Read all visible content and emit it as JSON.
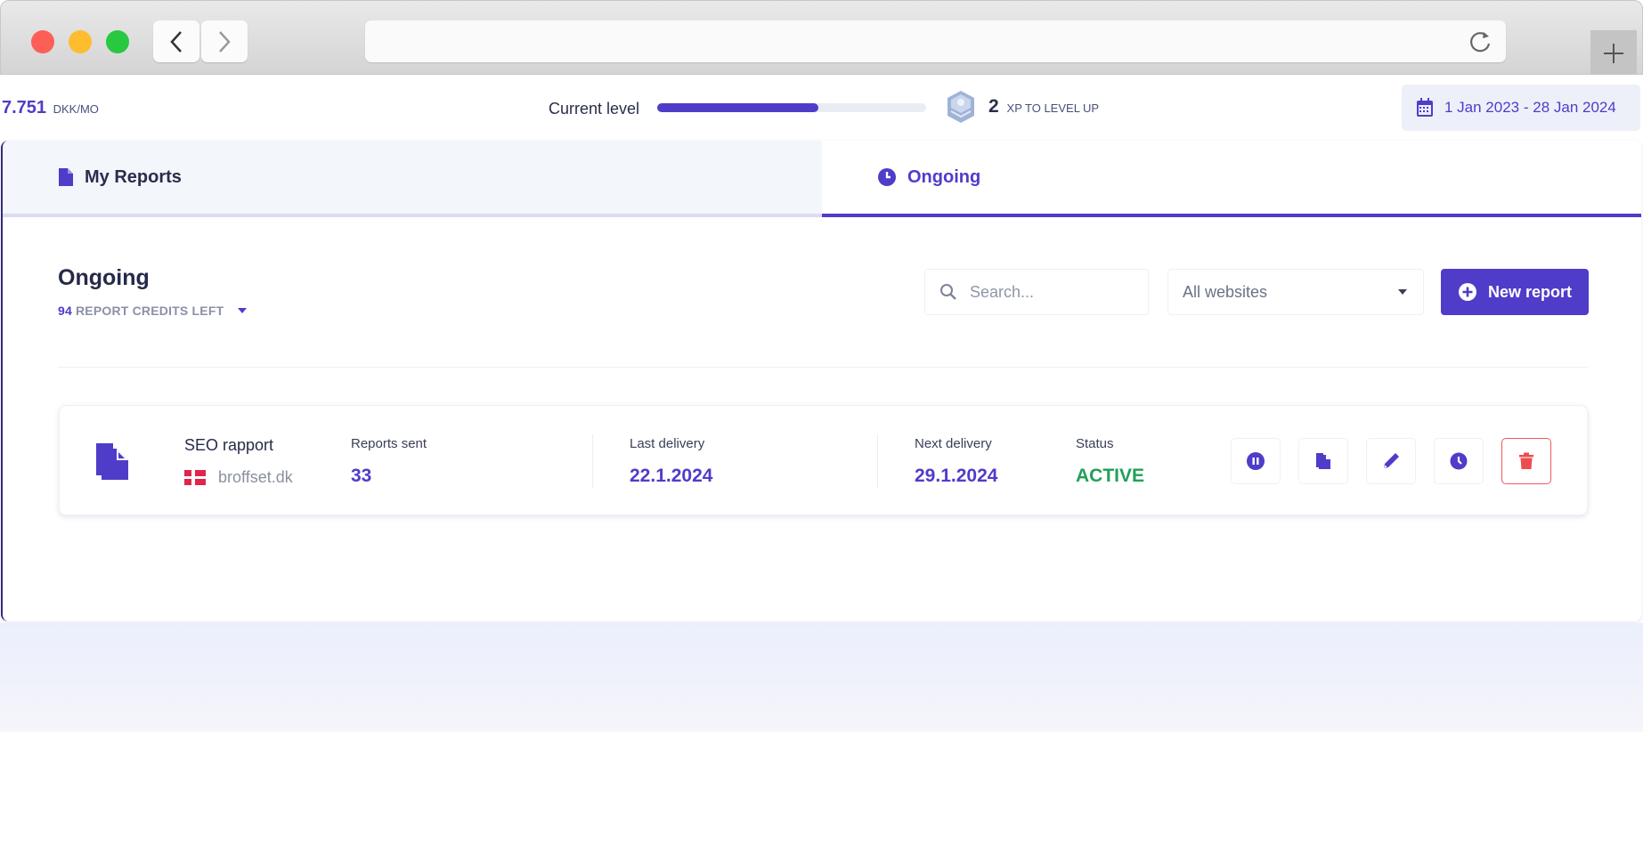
{
  "browser": {
    "back_icon": "chevron-left-icon",
    "forward_icon": "chevron-right-icon",
    "reload_icon": "reload-icon",
    "new_tab_icon": "plus-icon",
    "url": ""
  },
  "topbar": {
    "earnings_value": "7.751",
    "earnings_unit": "DKK/MO",
    "level_label": "Current level",
    "level_progress_percent": 60,
    "xp_value": "2",
    "xp_label": "XP TO LEVEL UP",
    "date_range": "1 Jan 2023 - 28 Jan 2024"
  },
  "tabs": [
    {
      "label": "My Reports",
      "icon": "file-icon",
      "active": false
    },
    {
      "label": "Ongoing",
      "icon": "clock-icon",
      "active": true
    }
  ],
  "section": {
    "title": "Ongoing",
    "credits_count": "94",
    "credits_label": "REPORT CREDITS LEFT"
  },
  "controls": {
    "search_placeholder": "Search...",
    "search_value": "",
    "website_filter": "All websites",
    "new_report_label": "New report"
  },
  "reports": [
    {
      "name": "SEO rapport",
      "website": "broffset.dk",
      "country_flag": "denmark",
      "reports_sent_label": "Reports sent",
      "reports_sent": "33",
      "last_delivery_label": "Last delivery",
      "last_delivery": "22.1.2024",
      "next_delivery_label": "Next delivery",
      "next_delivery": "29.1.2024",
      "status_label": "Status",
      "status": "ACTIVE",
      "actions": [
        "pause",
        "duplicate",
        "edit",
        "schedule",
        "delete"
      ]
    }
  ],
  "colors": {
    "accent": "#4f3cc9",
    "active_status": "#21a05a",
    "danger": "#ee5a5f"
  }
}
